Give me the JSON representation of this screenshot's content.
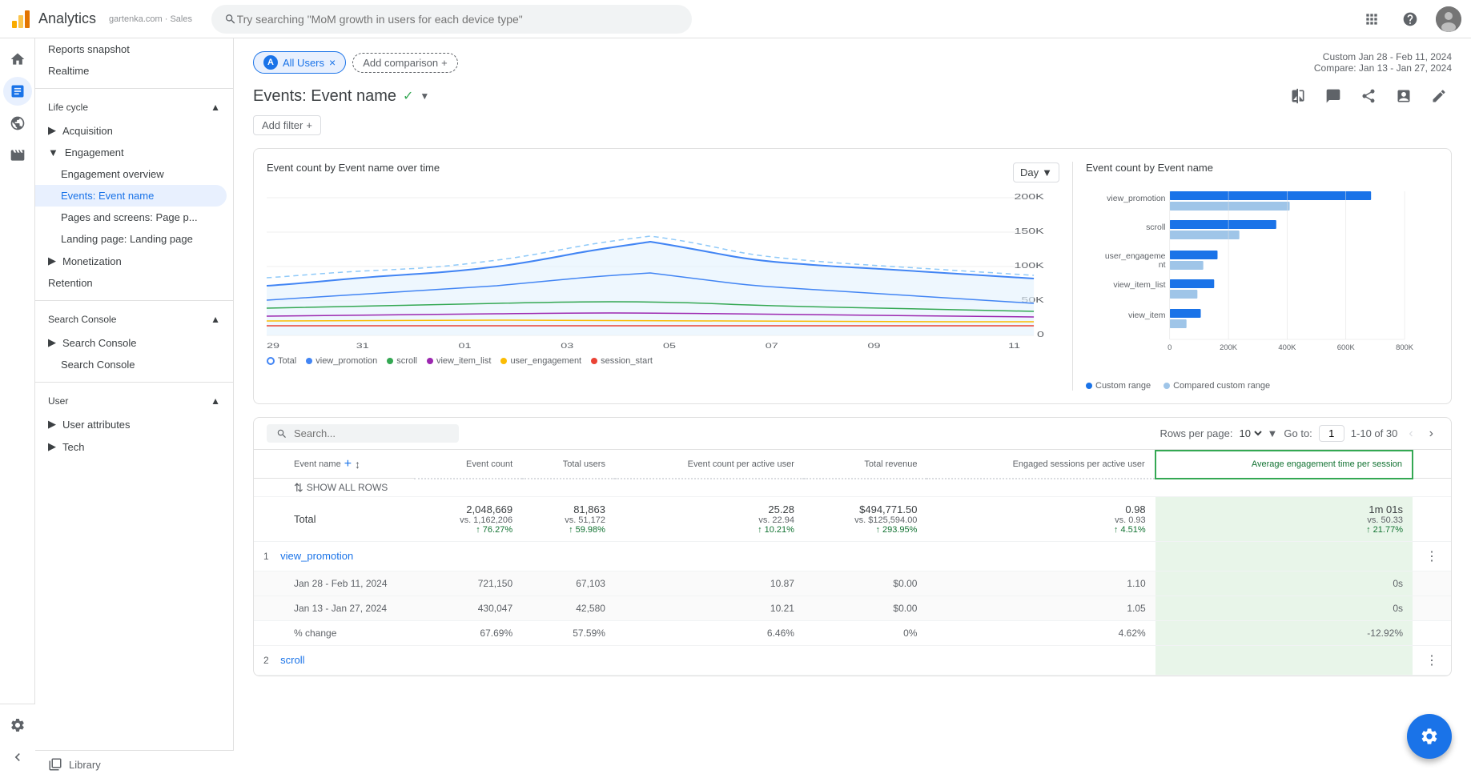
{
  "topbar": {
    "title": "Analytics",
    "account_text": "gartenka.com · Sales",
    "search_placeholder": "Try searching \"MoM growth in users for each device type\""
  },
  "nav_icons": [
    {
      "name": "home-icon",
      "label": "Home"
    },
    {
      "name": "reports-icon",
      "label": "Reports",
      "active": true
    },
    {
      "name": "explore-icon",
      "label": "Explore"
    },
    {
      "name": "advertising-icon",
      "label": "Advertising"
    }
  ],
  "sidebar": {
    "snapshot_label": "Reports snapshot",
    "realtime_label": "Realtime",
    "lifecycle_label": "Life cycle",
    "acquisition_label": "Acquisition",
    "engagement_label": "Engagement",
    "engagement_overview_label": "Engagement overview",
    "events_label": "Events: Event name",
    "pages_label": "Pages and screens: Page p...",
    "landing_label": "Landing page: Landing page",
    "monetization_label": "Monetization",
    "retention_label": "Retention",
    "search_console_section_label": "Search Console",
    "search_console_item1_label": "Search Console",
    "search_console_item2_label": "Search Console",
    "user_label": "User",
    "user_attributes_label": "User attributes",
    "tech_label": "Tech",
    "library_label": "Library",
    "settings_label": "Settings"
  },
  "page_header": {
    "all_users_label": "All Users",
    "add_comparison_label": "Add comparison",
    "date_range": "Custom  Jan 28 - Feb 11, 2024",
    "compare_range": "Compare: Jan 13 - Jan 27, 2024"
  },
  "report": {
    "title": "Events: Event name",
    "filter_btn_label": "Add filter"
  },
  "line_chart": {
    "title": "Event count by Event name over time",
    "day_selector": "Day",
    "x_labels": [
      "29 Jan",
      "31",
      "01 Feb",
      "03",
      "05",
      "07",
      "09",
      "11"
    ],
    "y_labels": [
      "200K",
      "150K",
      "100K",
      "50K",
      "0"
    ],
    "legend": [
      {
        "label": "Total",
        "type": "outline",
        "color": "#4285f4"
      },
      {
        "label": "view_promotion",
        "color": "#4285f4"
      },
      {
        "label": "scroll",
        "color": "#34a853"
      },
      {
        "label": "view_item_list",
        "color": "#9c27b0"
      },
      {
        "label": "user_engagement",
        "color": "#fbbc04"
      },
      {
        "label": "session_start",
        "color": "#ea4335"
      }
    ]
  },
  "bar_chart": {
    "title": "Event count by Event name",
    "items": [
      {
        "label": "view_promotion",
        "custom": 720000,
        "compared": 430000,
        "max": 800000
      },
      {
        "label": "scroll",
        "custom": 380000,
        "compared": 250000,
        "max": 800000
      },
      {
        "label": "user_engagement",
        "custom": 170000,
        "compared": 120000,
        "max": 800000
      },
      {
        "label": "view_item_list",
        "custom": 160000,
        "compared": 100000,
        "max": 800000
      },
      {
        "label": "view_item",
        "custom": 110000,
        "compared": 60000,
        "max": 800000
      }
    ],
    "x_labels": [
      "0",
      "200K",
      "400K",
      "600K",
      "800K"
    ],
    "legend": {
      "custom_label": "Custom range",
      "compared_label": "Compared custom range",
      "custom_color": "#1a73e8",
      "compared_color": "#9fc5e8"
    }
  },
  "table": {
    "search_placeholder": "Search...",
    "rows_per_page_label": "Rows per page:",
    "rows_per_page_value": "10",
    "goto_label": "Go to:",
    "goto_value": "1",
    "pagination": "1-10 of 30",
    "show_all_rows_label": "SHOW ALL ROWS",
    "columns": [
      {
        "label": "Event name",
        "key": "event_name"
      },
      {
        "label": "Event count",
        "key": "event_count",
        "dotted": true
      },
      {
        "label": "Total users",
        "key": "total_users",
        "dotted": true
      },
      {
        "label": "Event count per active user",
        "key": "event_count_active",
        "dotted": true
      },
      {
        "label": "Total revenue",
        "key": "total_revenue",
        "dotted": true
      },
      {
        "label": "Engaged sessions per active user",
        "key": "engaged_sessions",
        "dotted": true
      },
      {
        "label": "Average engagement time per session",
        "key": "avg_engagement",
        "dotted": true,
        "highlighted": true
      }
    ],
    "total": {
      "label": "Total",
      "event_count": "2,048,669",
      "event_count_vs": "vs. 1,162,206",
      "event_count_change": "↑ 76.27%",
      "total_users": "81,863",
      "total_users_vs": "vs. 51,172",
      "total_users_change": "↑ 59.98%",
      "event_count_active": "25.28",
      "event_count_active_vs": "vs. 22.94",
      "event_count_active_change": "↑ 10.21%",
      "total_revenue": "$494,771.50",
      "total_revenue_vs": "vs. $125,594.00",
      "total_revenue_change": "↑ 293.95%",
      "engaged_sessions": "0.98",
      "engaged_sessions_vs": "vs. 0.93",
      "engaged_sessions_change": "↑ 4.51%",
      "avg_engagement": "1m 01s",
      "avg_engagement_vs": "vs. 50.33",
      "avg_engagement_change": "↑ 21.77%"
    },
    "rows": [
      {
        "num": "1",
        "name": "view_promotion",
        "period1_label": "Jan 28 - Feb 11, 2024",
        "period1_event_count": "721,150",
        "period1_total_users": "67,103",
        "period1_event_count_active": "10.87",
        "period1_total_revenue": "$0.00",
        "period1_engaged_sessions": "1.10",
        "period1_avg_engagement": "0s",
        "period2_label": "Jan 13 - Jan 27, 2024",
        "period2_event_count": "430,047",
        "period2_total_users": "42,580",
        "period2_event_count_active": "10.21",
        "period2_total_revenue": "$0.00",
        "period2_engaged_sessions": "1.05",
        "period2_avg_engagement": "0s",
        "change_label": "% change",
        "change_event_count": "67.69%",
        "change_total_users": "57.59%",
        "change_event_count_active": "6.46%",
        "change_total_revenue": "0%",
        "change_engaged_sessions": "4.62%",
        "change_avg_engagement": "-12.92%"
      },
      {
        "num": "2",
        "name": "scroll"
      }
    ]
  }
}
